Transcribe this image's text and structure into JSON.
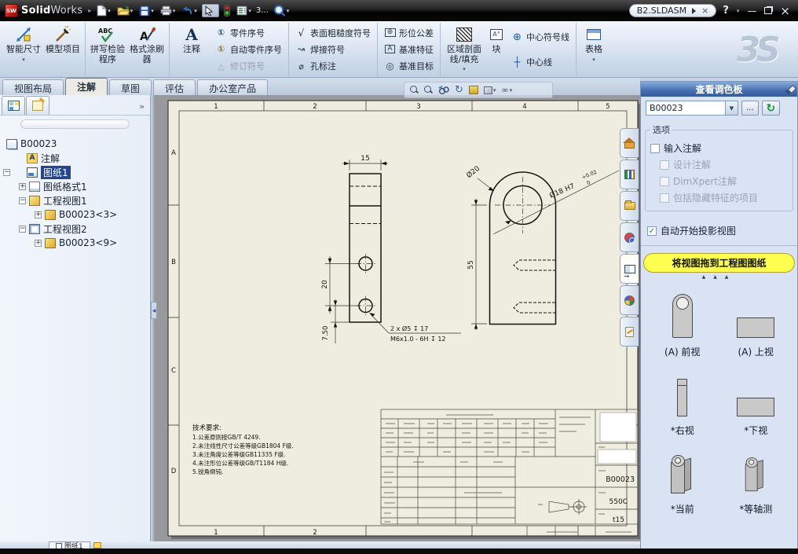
{
  "titlebar": {
    "app_name_bold": "Solid",
    "app_name_light": "Works",
    "doc_tab": "B2.SLDASM",
    "toolbar_overflow": "3..."
  },
  "ribbon": {
    "smart_dim": "智能尺寸",
    "model_items": "模型项目",
    "spell_checker": "拼写检验程序",
    "format_painter": "格式涂刷器",
    "note": "注释",
    "balloon": "零件序号",
    "auto_balloon": "自动零件序号",
    "revision_symbol": "修订符号",
    "surface_finish": "表面粗糙度符号",
    "weld_symbol": "焊接符号",
    "hole_callout": "孔标注",
    "geometric_tolerance": "形位公差",
    "datum_feature": "基准特征",
    "datum_target": "基准目标",
    "area_hatch": "区域剖面线/填充",
    "block": "块",
    "center_mark": "中心符号线",
    "centerline": "中心线",
    "table": "表格"
  },
  "tabs": {
    "view_layout": "视图布局",
    "annotation": "注解",
    "sketch": "草图",
    "evaluate": "评估",
    "office": "办公室产品"
  },
  "tree": {
    "root": "B00023",
    "note": "注解",
    "sheet": "图纸1",
    "sheet_format": "图纸格式1",
    "view1": "工程视图1",
    "view1_part": "B00023<3>",
    "view2": "工程视图2",
    "view2_part": "B00023<9>"
  },
  "taskpane": {
    "title": "查看调色板",
    "combo_value": "B00023",
    "browse": "...",
    "options_legend": "选项",
    "chk_import": "输入注解",
    "chk_design": "设计注解",
    "chk_dimxpert": "DimXpert注解",
    "chk_hidden": "包括隐藏特征的项目",
    "chk_autostart": "自动开始投影视图",
    "hint": "将视图拖到工程图图纸",
    "views": [
      {
        "label": "(A) 前视"
      },
      {
        "label": "(A) 上视"
      },
      {
        "label": "*右视"
      },
      {
        "label": "*下视"
      },
      {
        "label": "*当前"
      },
      {
        "label": "*等轴测"
      }
    ]
  },
  "drawing": {
    "zones_top": [
      "1",
      "2",
      "3",
      "4",
      "5"
    ],
    "zones_bottom": [
      "1",
      "2"
    ],
    "zones_left": [
      "A",
      "B",
      "C",
      "D"
    ],
    "dims": {
      "width": "15",
      "hole_spacing": "20",
      "hole_edge": "7.50",
      "height": "55",
      "outer_dia": "Ø20",
      "bore": "Ø18 H7",
      "bore_tol_up": "+0.02",
      "bore_tol_low": "0",
      "hole_callout_1": "2 x Ø5 ↧ 17",
      "hole_callout_2": "M6x1.0 - 6H ↧ 12"
    },
    "tech_title": "技术要求:",
    "tech_lines": [
      "1.公差原则按GB/T 4249.",
      "2.未注线性尺寸公差等级GB1804 F级.",
      "3.未注角度公差等级GB11335 F级.",
      "4.未注形位公差等级GB/T1184 H级.",
      "5.锐角倒钝."
    ],
    "titleblock": {
      "part_no": "B00023",
      "material": "550C",
      "thickness": "t15"
    }
  },
  "statusbar": {
    "sheet_tab": "图纸1"
  }
}
